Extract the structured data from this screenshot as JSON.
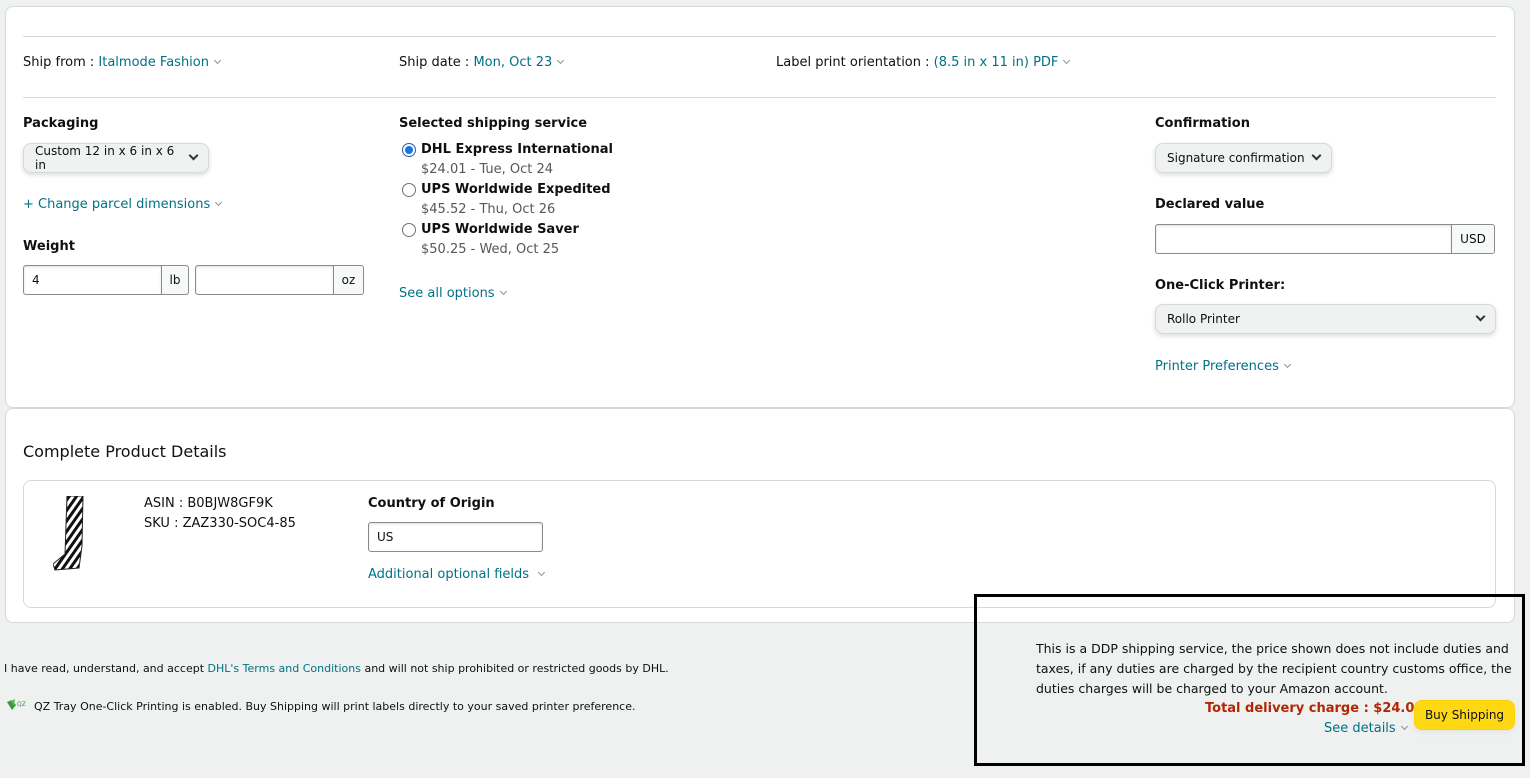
{
  "top": {
    "ship_from_label": "Ship from :",
    "ship_from_value": "Italmode Fashion",
    "ship_date_label": "Ship date :",
    "ship_date_value": "Mon, Oct 23",
    "label_orientation_label": "Label print orientation :",
    "label_orientation_value": "(8.5 in x 11 in) PDF"
  },
  "packaging": {
    "label": "Packaging",
    "selected": "Custom 12 in x 6 in x 6 in",
    "change_dimensions": "+ Change parcel dimensions"
  },
  "weight": {
    "label": "Weight",
    "lb_value": "4",
    "lb_unit": "lb",
    "oz_value": "",
    "oz_unit": "oz"
  },
  "shipping_service": {
    "label": "Selected shipping service",
    "options": [
      {
        "name": "DHL Express International",
        "detail": "$24.01 - Tue, Oct 24",
        "selected": true
      },
      {
        "name": "UPS Worldwide Expedited",
        "detail": "$45.52 - Thu, Oct 26",
        "selected": false
      },
      {
        "name": "UPS Worldwide Saver",
        "detail": "$50.25 - Wed, Oct 25",
        "selected": false
      }
    ],
    "see_all": "See all options"
  },
  "confirmation": {
    "label": "Confirmation",
    "selected": "Signature confirmation"
  },
  "declared_value": {
    "label": "Declared value",
    "value": "",
    "currency": "USD"
  },
  "printer": {
    "label": "One-Click Printer:",
    "selected": "Rollo Printer",
    "preferences": "Printer Preferences"
  },
  "product": {
    "section_title": "Complete Product Details",
    "asin": "ASIN : B0BJW8GF9K",
    "sku": "SKU : ZAZ330-SOC4-85",
    "country_label": "Country of Origin",
    "country_value": "US",
    "additional_fields": "Additional optional fields"
  },
  "footer": {
    "terms_prefix": "I have read, understand, and accept ",
    "terms_link": "DHL's Terms and Conditions",
    "terms_suffix": " and will not ship prohibited or restricted goods by DHL.",
    "qz_text": "QZ Tray One-Click Printing is enabled. Buy Shipping will print labels directly to your saved printer preference."
  },
  "notice": {
    "line1": "This is a DDP shipping service, the price shown does not include duties and",
    "line2": "taxes, if any duties are charged by the recipient country customs office, the",
    "line3": "duties charges will be charged to your Amazon account.",
    "total": "Total delivery charge : $24.01",
    "see_details": "See details",
    "buy_button": "Buy Shipping"
  },
  "colors": {
    "link": "#007185",
    "total": "#b12704",
    "button": "#ffd814",
    "radio": "#1a73e8"
  }
}
